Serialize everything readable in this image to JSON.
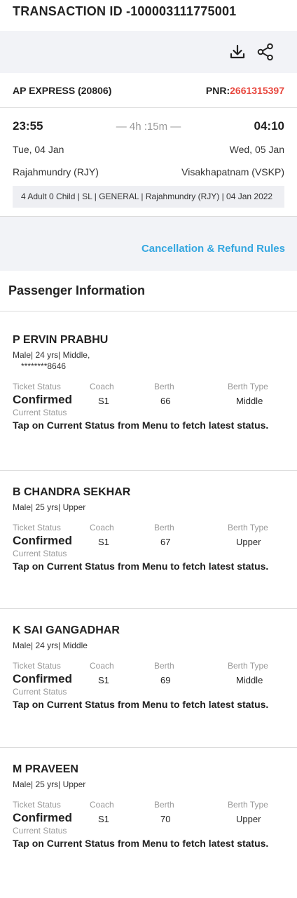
{
  "transaction": {
    "title": "TRANSACTION ID -100003111775001"
  },
  "actions": {
    "download_icon": "download-icon",
    "share_icon": "share-icon"
  },
  "train": {
    "name": "AP EXPRESS (20806)",
    "pnr_label": "PNR:",
    "pnr_value": "2661315397",
    "departure_time": "23:55",
    "duration": "— 4h :15m —",
    "arrival_time": "04:10",
    "departure_date": "Tue, 04 Jan",
    "arrival_date": "Wed, 05 Jan",
    "from_station": "Rajahmundry (RJY)",
    "to_station": "Visakhapatnam (VSKP)",
    "summary": "4 Adult 0 Child | SL | GENERAL | Rajahmundry (RJY) | 04 Jan 2022"
  },
  "rules": {
    "link": "Cancellation & Refund Rules"
  },
  "colors": {
    "pnr": "#e8473e",
    "link": "#35a7e0",
    "band": "#f2f3f7"
  },
  "passenger_section": {
    "title": "Passenger Information"
  },
  "labels": {
    "ticket_status": "Ticket Status",
    "coach": "Coach",
    "berth": "Berth",
    "berth_type": "Berth Type",
    "current_status": "Current Status",
    "tap_msg": "Tap on Current Status from Menu to fetch latest status."
  },
  "passengers": [
    {
      "name": "P ERVIN PRABHU",
      "details": "Male| 24 yrs| Middle,",
      "masked": "********8646",
      "status": "Confirmed",
      "coach": "S1",
      "berth": "66",
      "berth_type": "Middle"
    },
    {
      "name": "B CHANDRA SEKHAR",
      "details": "Male| 25 yrs| Upper",
      "status": "Confirmed",
      "coach": "S1",
      "berth": "67",
      "berth_type": "Upper"
    },
    {
      "name": "K SAI GANGADHAR",
      "details": "Male| 24 yrs| Middle",
      "status": "Confirmed",
      "coach": "S1",
      "berth": "69",
      "berth_type": "Middle"
    },
    {
      "name": "M PRAVEEN",
      "details": "Male| 25 yrs| Upper",
      "status": "Confirmed",
      "coach": "S1",
      "berth": "70",
      "berth_type": "Upper"
    }
  ]
}
